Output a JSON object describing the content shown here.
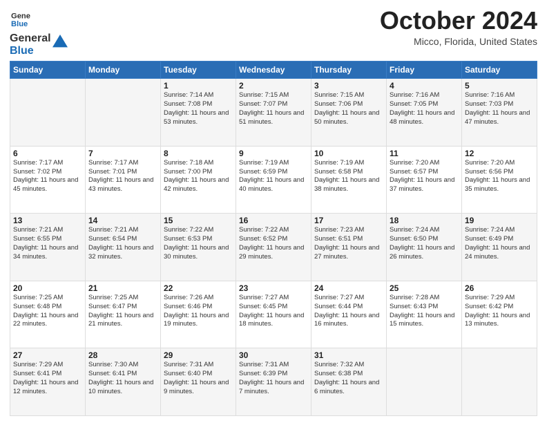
{
  "header": {
    "logo_line1": "General",
    "logo_line2": "Blue",
    "month": "October 2024",
    "location": "Micco, Florida, United States"
  },
  "weekdays": [
    "Sunday",
    "Monday",
    "Tuesday",
    "Wednesday",
    "Thursday",
    "Friday",
    "Saturday"
  ],
  "weeks": [
    [
      {
        "day": "",
        "info": ""
      },
      {
        "day": "",
        "info": ""
      },
      {
        "day": "1",
        "info": "Sunrise: 7:14 AM\nSunset: 7:08 PM\nDaylight: 11 hours and 53 minutes."
      },
      {
        "day": "2",
        "info": "Sunrise: 7:15 AM\nSunset: 7:07 PM\nDaylight: 11 hours and 51 minutes."
      },
      {
        "day": "3",
        "info": "Sunrise: 7:15 AM\nSunset: 7:06 PM\nDaylight: 11 hours and 50 minutes."
      },
      {
        "day": "4",
        "info": "Sunrise: 7:16 AM\nSunset: 7:05 PM\nDaylight: 11 hours and 48 minutes."
      },
      {
        "day": "5",
        "info": "Sunrise: 7:16 AM\nSunset: 7:03 PM\nDaylight: 11 hours and 47 minutes."
      }
    ],
    [
      {
        "day": "6",
        "info": "Sunrise: 7:17 AM\nSunset: 7:02 PM\nDaylight: 11 hours and 45 minutes."
      },
      {
        "day": "7",
        "info": "Sunrise: 7:17 AM\nSunset: 7:01 PM\nDaylight: 11 hours and 43 minutes."
      },
      {
        "day": "8",
        "info": "Sunrise: 7:18 AM\nSunset: 7:00 PM\nDaylight: 11 hours and 42 minutes."
      },
      {
        "day": "9",
        "info": "Sunrise: 7:19 AM\nSunset: 6:59 PM\nDaylight: 11 hours and 40 minutes."
      },
      {
        "day": "10",
        "info": "Sunrise: 7:19 AM\nSunset: 6:58 PM\nDaylight: 11 hours and 38 minutes."
      },
      {
        "day": "11",
        "info": "Sunrise: 7:20 AM\nSunset: 6:57 PM\nDaylight: 11 hours and 37 minutes."
      },
      {
        "day": "12",
        "info": "Sunrise: 7:20 AM\nSunset: 6:56 PM\nDaylight: 11 hours and 35 minutes."
      }
    ],
    [
      {
        "day": "13",
        "info": "Sunrise: 7:21 AM\nSunset: 6:55 PM\nDaylight: 11 hours and 34 minutes."
      },
      {
        "day": "14",
        "info": "Sunrise: 7:21 AM\nSunset: 6:54 PM\nDaylight: 11 hours and 32 minutes."
      },
      {
        "day": "15",
        "info": "Sunrise: 7:22 AM\nSunset: 6:53 PM\nDaylight: 11 hours and 30 minutes."
      },
      {
        "day": "16",
        "info": "Sunrise: 7:22 AM\nSunset: 6:52 PM\nDaylight: 11 hours and 29 minutes."
      },
      {
        "day": "17",
        "info": "Sunrise: 7:23 AM\nSunset: 6:51 PM\nDaylight: 11 hours and 27 minutes."
      },
      {
        "day": "18",
        "info": "Sunrise: 7:24 AM\nSunset: 6:50 PM\nDaylight: 11 hours and 26 minutes."
      },
      {
        "day": "19",
        "info": "Sunrise: 7:24 AM\nSunset: 6:49 PM\nDaylight: 11 hours and 24 minutes."
      }
    ],
    [
      {
        "day": "20",
        "info": "Sunrise: 7:25 AM\nSunset: 6:48 PM\nDaylight: 11 hours and 22 minutes."
      },
      {
        "day": "21",
        "info": "Sunrise: 7:25 AM\nSunset: 6:47 PM\nDaylight: 11 hours and 21 minutes."
      },
      {
        "day": "22",
        "info": "Sunrise: 7:26 AM\nSunset: 6:46 PM\nDaylight: 11 hours and 19 minutes."
      },
      {
        "day": "23",
        "info": "Sunrise: 7:27 AM\nSunset: 6:45 PM\nDaylight: 11 hours and 18 minutes."
      },
      {
        "day": "24",
        "info": "Sunrise: 7:27 AM\nSunset: 6:44 PM\nDaylight: 11 hours and 16 minutes."
      },
      {
        "day": "25",
        "info": "Sunrise: 7:28 AM\nSunset: 6:43 PM\nDaylight: 11 hours and 15 minutes."
      },
      {
        "day": "26",
        "info": "Sunrise: 7:29 AM\nSunset: 6:42 PM\nDaylight: 11 hours and 13 minutes."
      }
    ],
    [
      {
        "day": "27",
        "info": "Sunrise: 7:29 AM\nSunset: 6:41 PM\nDaylight: 11 hours and 12 minutes."
      },
      {
        "day": "28",
        "info": "Sunrise: 7:30 AM\nSunset: 6:41 PM\nDaylight: 11 hours and 10 minutes."
      },
      {
        "day": "29",
        "info": "Sunrise: 7:31 AM\nSunset: 6:40 PM\nDaylight: 11 hours and 9 minutes."
      },
      {
        "day": "30",
        "info": "Sunrise: 7:31 AM\nSunset: 6:39 PM\nDaylight: 11 hours and 7 minutes."
      },
      {
        "day": "31",
        "info": "Sunrise: 7:32 AM\nSunset: 6:38 PM\nDaylight: 11 hours and 6 minutes."
      },
      {
        "day": "",
        "info": ""
      },
      {
        "day": "",
        "info": ""
      }
    ]
  ]
}
